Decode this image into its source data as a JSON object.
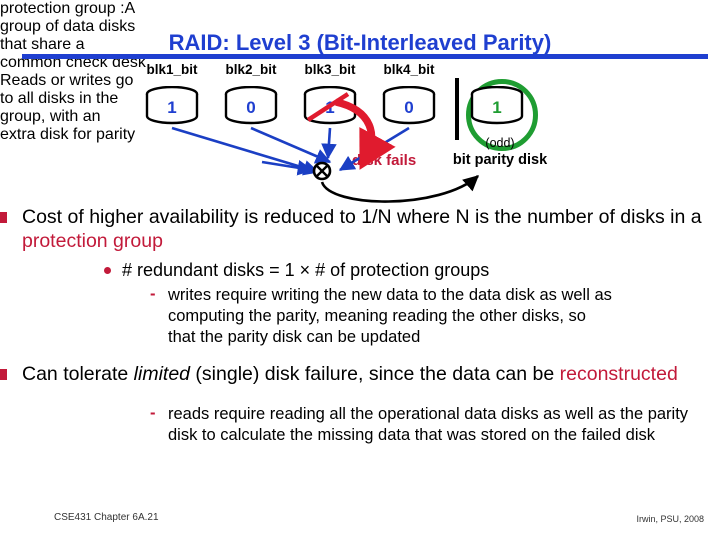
{
  "slide": {
    "title": "RAID: Level 3 (Bit-Interleaved Parity)",
    "accent_blue": "#1f3fd0",
    "accent_red": "#c21a3a",
    "accent_green": "#1f9d32"
  },
  "callouts": {
    "left": "protection group :A group of data disks that share a common check desk",
    "left_term": "protection group",
    "left_rest": " :A group of data disks that share a common check desk",
    "right": "Reads or writes go to all disks in the group, with an extra disk for parity"
  },
  "diagram": {
    "disks": [
      {
        "label": "blk1_bit",
        "value": "1",
        "failed": false,
        "parity": false
      },
      {
        "label": "blk2_bit",
        "value": "0",
        "failed": false,
        "parity": false
      },
      {
        "label": "blk3_bit",
        "value": "1",
        "failed": true,
        "parity": false
      },
      {
        "label": "blk4_bit",
        "value": "0",
        "failed": false,
        "parity": false
      },
      {
        "label": "",
        "value": "1",
        "failed": false,
        "parity": true
      }
    ],
    "xor_symbol": "⊕",
    "parity_note": "(odd)",
    "parity_caption": "bit parity disk",
    "fail_caption": "disk fails"
  },
  "body": {
    "b1_pre": "Cost of higher availability is reduced to 1/N where N is the number of disks in a ",
    "b1_red": "protection group",
    "b2": "# redundant disks = 1 × # of protection groups",
    "b3_line1": "writes require writing the new data to the data disk as well as",
    "b3_line2": "computing the parity, meaning reading the other disks, so",
    "b3_line3": "that the parity disk can be updated",
    "b4_pre": "Can tolerate ",
    "b4_ital": "limited",
    "b4_mid": " (single) disk failure, since the data can be ",
    "b4_red": "reconstructed",
    "b5_line1": "reads require reading all the operational data disks as well as the parity",
    "b5_line2": "disk to calculate the missing data that was stored on the failed disk"
  },
  "footer": {
    "left": "CSE431  Chapter 6A.21",
    "right": "Irwin, PSU, 2008"
  }
}
